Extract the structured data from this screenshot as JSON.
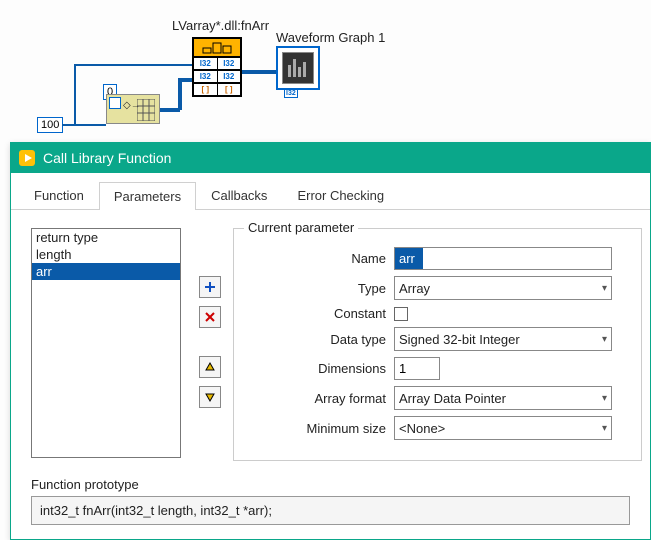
{
  "diagram": {
    "cln_label": "LVarray*.dll:fnArr",
    "graph_label": "Waveform Graph 1",
    "const_zero": "0",
    "const_hundred": "100"
  },
  "dialog": {
    "title": "Call Library Function",
    "tabs": [
      "Function",
      "Parameters",
      "Callbacks",
      "Error Checking"
    ],
    "active_tab": 1,
    "param_list": [
      "return type",
      "length",
      "arr"
    ],
    "selected_index": 2,
    "group_title": "Current parameter",
    "labels": {
      "name": "Name",
      "type": "Type",
      "constant": "Constant",
      "datatype": "Data type",
      "dimensions": "Dimensions",
      "array_format": "Array format",
      "minimum_size": "Minimum size"
    },
    "values": {
      "name": "arr",
      "type": "Array",
      "datatype": "Signed 32-bit Integer",
      "dimensions": "1",
      "array_format": "Array Data Pointer",
      "minimum_size": "<None>"
    },
    "prototype_label": "Function prototype",
    "prototype": "int32_t fnArr(int32_t length, int32_t *arr);"
  }
}
